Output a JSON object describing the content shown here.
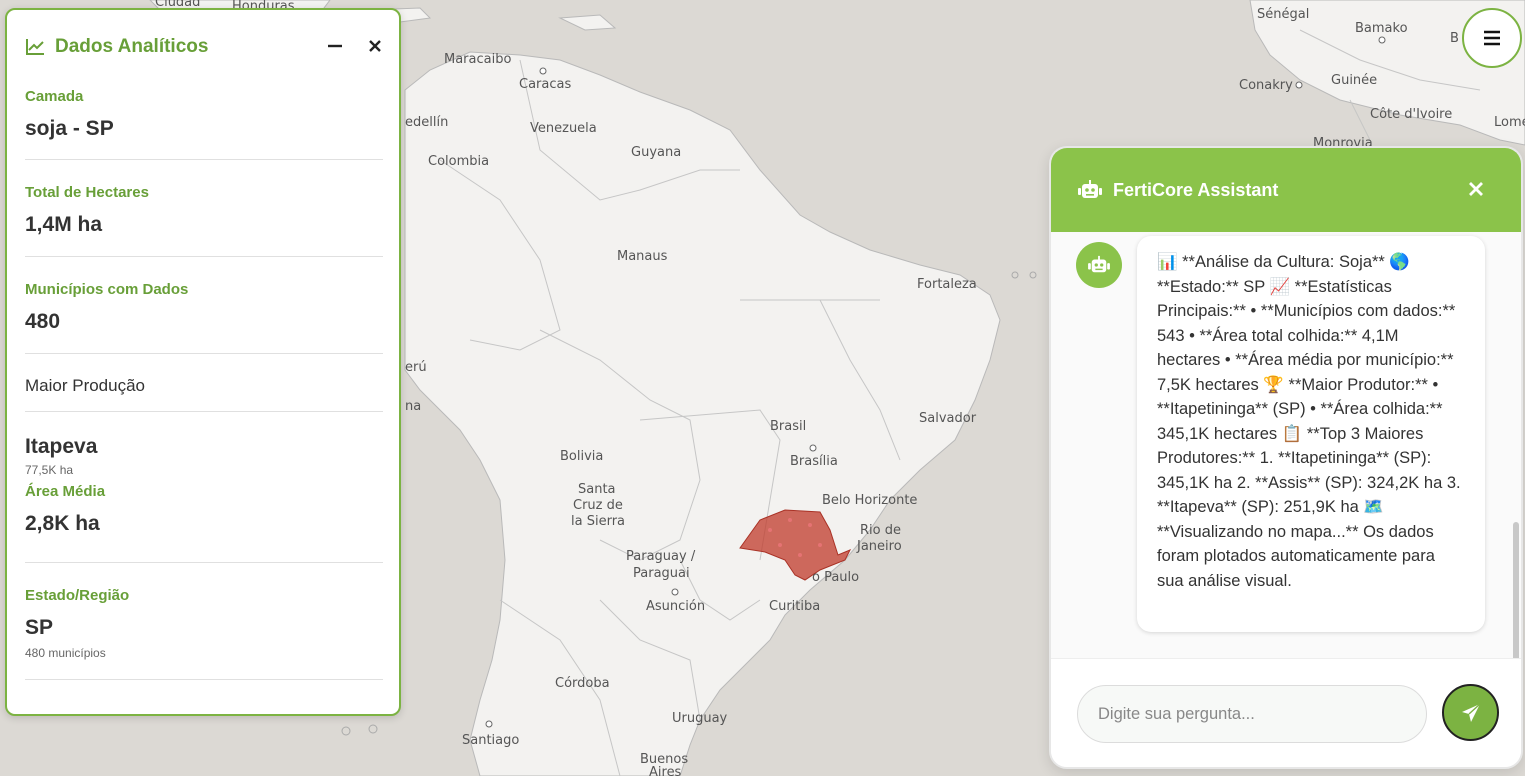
{
  "map": {
    "labels": {
      "ciudad": "Ciudad",
      "honduras": "Honduras",
      "maracaibo": "Maracaibo",
      "caracas": "Caracas",
      "medellin": "edellín",
      "venezuela": "Venezuela",
      "colombia": "Colombia",
      "guyana": "Guyana",
      "manaus": "Manaus",
      "fortaleza": "Fortaleza",
      "peru": "erú",
      "na": "na",
      "salvador": "Salvador",
      "brasil": "Brasil",
      "brasilia": "Brasília",
      "bolivia": "Bolivia",
      "santa": "Santa",
      "cruz_de": "Cruz de",
      "la_sierra": "la Sierra",
      "belo_horizonte": "Belo Horizonte",
      "rio_de": "Rio de",
      "janeiro": "Janeiro",
      "paraguay": "Paraguay /",
      "paraguai": "Paraguai",
      "sao_paulo": "o Paulo",
      "asuncion": "Asunción",
      "curitiba": "Curitiba",
      "cordoba": "Córdoba",
      "uruguay": "Uruguay",
      "santiago": "Santiago",
      "buenos": "Buenos",
      "aires": "Aires",
      "senegal": "Sénégal",
      "bamako": "Bamako",
      "conakry": "Conakry",
      "guinee": "Guinée",
      "cote_divoire": "Côte d'Ivoire",
      "monrovia": "Monrovia",
      "lome": "Lomé",
      "b": "B"
    }
  },
  "analytics": {
    "title": "Dados Analíticos",
    "layer_label": "Camada",
    "layer_value": "soja - SP",
    "hectares_label": "Total de Hectares",
    "hectares_value": "1,4M ha",
    "municipios_label": "Municípios com Dados",
    "municipios_value": "480",
    "maior_label": "Maior Produção",
    "maior_value": "Itapeva",
    "maior_sub": "77,5K ha",
    "media_label": "Área Média",
    "media_value": "2,8K ha",
    "estado_label": "Estado/Região",
    "estado_value": "SP",
    "estado_sub": "480 municípios"
  },
  "chat": {
    "title": "FertiCore Assistant",
    "message": "📊 **Análise da Cultura: Soja** 🌎 **Estado:** SP 📈 **Estatísticas Principais:** • **Municípios com dados:** 543 • **Área total colhida:** 4,1M hectares • **Área média por município:** 7,5K hectares 🏆 **Maior Produtor:** • **Itapetininga** (SP) • **Área colhida:** 345,1K hectares 📋 **Top 3 Maiores Produtores:** 1. **Itapetininga** (SP): 345,1K ha 2. **Assis** (SP): 324,2K ha 3. **Itapeva** (SP): 251,9K ha 🗺️ **Visualizando no mapa...** Os dados foram plotados automaticamente para sua análise visual.",
    "input_placeholder": "Digite sua pergunta..."
  },
  "colors": {
    "accent": "#8bc34a",
    "accent_dark": "#689f38",
    "highlight_region": "#c0392b"
  }
}
